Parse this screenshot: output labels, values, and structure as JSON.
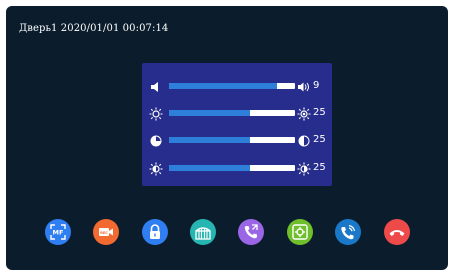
{
  "header": {
    "text": "Дверь1 2020/01/01 00:07:14"
  },
  "settings": {
    "rows": [
      {
        "name": "volume",
        "value": "9",
        "level_fraction": 0.86
      },
      {
        "name": "brightness",
        "value": "25",
        "level_fraction": 0.64
      },
      {
        "name": "contrast",
        "value": "25",
        "level_fraction": 0.64
      },
      {
        "name": "color",
        "value": "25",
        "level_fraction": 0.64
      }
    ]
  },
  "toolbar": {
    "buttons": [
      {
        "icon": "manual-focus-icon",
        "label": "MF",
        "color": "#2f7ef2"
      },
      {
        "icon": "video-record-icon",
        "label": "REC",
        "color": "#f26a2f"
      },
      {
        "icon": "unlock-icon",
        "color": "#2f7ef2"
      },
      {
        "icon": "gate-icon",
        "color": "#26b5b0"
      },
      {
        "icon": "call-transfer-icon",
        "color": "#9a66e6"
      },
      {
        "icon": "settings-icon",
        "color": "#6fbf2d"
      },
      {
        "icon": "call-icon",
        "color": "#1b78c8"
      },
      {
        "icon": "hang-up-icon",
        "color": "#ee4a4a"
      }
    ]
  }
}
